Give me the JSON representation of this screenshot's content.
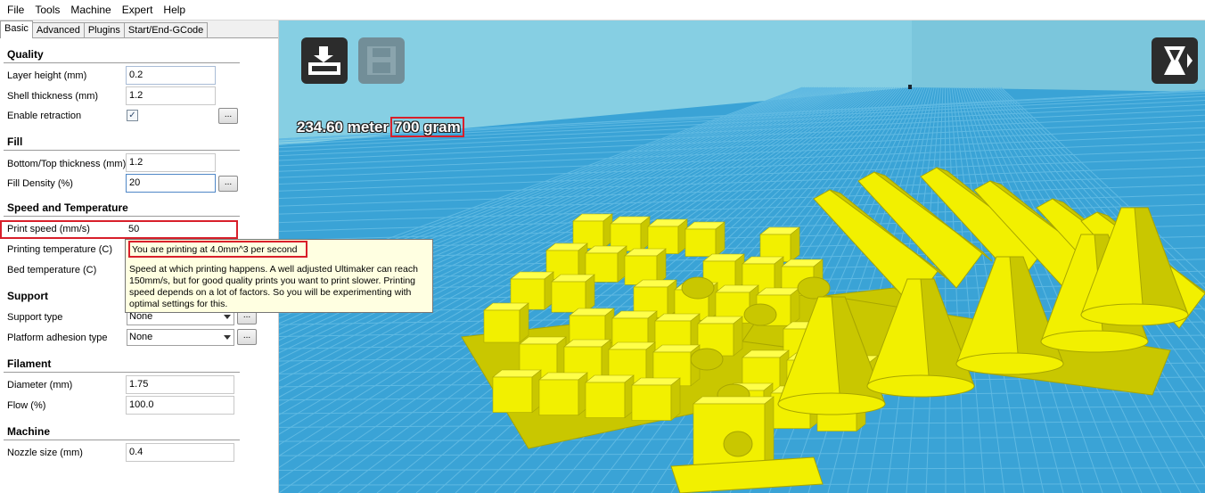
{
  "menu": [
    "File",
    "Tools",
    "Machine",
    "Expert",
    "Help"
  ],
  "tabs": [
    "Basic",
    "Advanced",
    "Plugins",
    "Start/End-GCode"
  ],
  "quality": {
    "title": "Quality",
    "layer_height_label": "Layer height (mm)",
    "layer_height_value": "0.2",
    "shell_thickness_label": "Shell thickness (mm)",
    "shell_thickness_value": "1.2",
    "enable_retraction_label": "Enable retraction",
    "enable_retraction_checked": true
  },
  "fill": {
    "title": "Fill",
    "bottom_top_label": "Bottom/Top thickness (mm)",
    "bottom_top_value": "1.2",
    "density_label": "Fill Density (%)",
    "density_value": "20"
  },
  "speed": {
    "title": "Speed and Temperature",
    "print_speed_label": "Print speed (mm/s)",
    "print_speed_value": "50",
    "printing_temp_label": "Printing temperature (C)",
    "bed_temp_label": "Bed temperature (C)"
  },
  "support": {
    "title": "Support",
    "support_type_label": "Support type",
    "support_type_value": "None",
    "adhesion_label": "Platform adhesion type",
    "adhesion_value": "None"
  },
  "filament": {
    "title": "Filament",
    "diameter_label": "Diameter (mm)",
    "diameter_value": "1.75",
    "flow_label": "Flow (%)",
    "flow_value": "100.0"
  },
  "machine": {
    "title": "Machine",
    "nozzle_label": "Nozzle size (mm)",
    "nozzle_value": "0.4"
  },
  "dots_label": "...",
  "tooltip": {
    "head": "You are printing at 4.0mm^3 per second",
    "body": "Speed at which printing happens. A well adjusted Ultimaker can reach 150mm/s, but for good quality prints you want to print slower. Printing speed depends on a lot of factors. So you will be experimenting with optimal settings for this."
  },
  "viewport": {
    "length_text": "234.60 meter",
    "weight_text": "700 gram",
    "sky_color": "#7ecbe0",
    "grid_color": "#3aa3d6",
    "model_color": "#f2f000",
    "buttons": [
      "load-model-icon",
      "save-gcode-icon",
      "view-mode-icon"
    ]
  },
  "accent_red": "#d81f2a"
}
